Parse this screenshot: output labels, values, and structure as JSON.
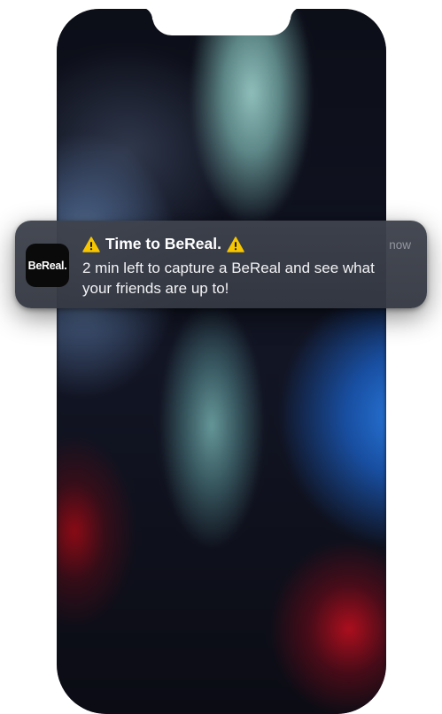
{
  "notification": {
    "app_name": "BeReal.",
    "title": "Time to BeReal.",
    "title_prefix_icon": "warning-icon",
    "title_suffix_icon": "warning-icon",
    "time": "now",
    "body": "2 min left to capture a BeReal and see what your friends are up to!"
  },
  "colors": {
    "warning_yellow": "#F7C600",
    "banner_bg": "#3E424C",
    "app_icon_bg": "#0A0A0A"
  }
}
